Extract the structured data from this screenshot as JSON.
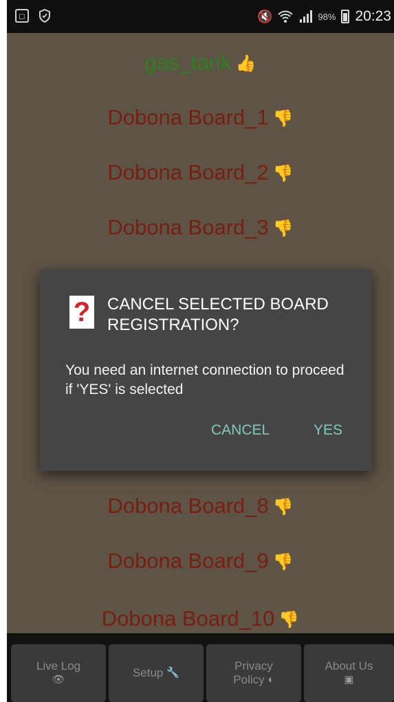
{
  "status_bar": {
    "time": "20:23",
    "battery_percent": "98%",
    "icons": [
      "screen-cast-icon",
      "shield-icon",
      "mute-vibrate-icon",
      "wifi-icon",
      "signal-icon",
      "battery-icon"
    ]
  },
  "boards": [
    {
      "name": "gas_tank",
      "status": "ok",
      "icon": "thumbs-up-icon"
    },
    {
      "name": "Dobona Board_1",
      "status": "bad",
      "icon": "thumbs-down-icon"
    },
    {
      "name": "Dobona Board_2",
      "status": "bad",
      "icon": "thumbs-down-icon"
    },
    {
      "name": "Dobona Board_3",
      "status": "bad",
      "icon": "thumbs-down-icon"
    },
    {
      "name": "Dobona Board_8",
      "status": "bad",
      "icon": "thumbs-down-icon"
    },
    {
      "name": "Dobona Board_9",
      "status": "bad",
      "icon": "thumbs-down-icon"
    },
    {
      "name": "Dobona Board_10",
      "status": "bad",
      "icon": "thumbs-down-icon"
    }
  ],
  "dialog": {
    "icon": "question-mark-icon",
    "title": "CANCEL SELECTED BOARD REGISTRATION?",
    "message": "You need an internet connection to proceed if 'YES' is selected",
    "cancel_label": "CANCEL",
    "yes_label": "YES"
  },
  "tabs": {
    "live_log": {
      "label": "Live Log",
      "icon": "eye-icon"
    },
    "setup": {
      "label": "Setup",
      "icon": "wrench-icon"
    },
    "privacy": {
      "label_line1": "Privacy",
      "label_line2": "Policy",
      "icon": "shield-half-icon"
    },
    "about": {
      "label": "About Us",
      "icon": "info-box-icon"
    }
  },
  "colors": {
    "background": "#5e5446",
    "ok_text": "#2f7f20",
    "bad_text": "#7a1d12",
    "dialog_bg": "#454545",
    "dialog_button": "#7fcaba"
  }
}
